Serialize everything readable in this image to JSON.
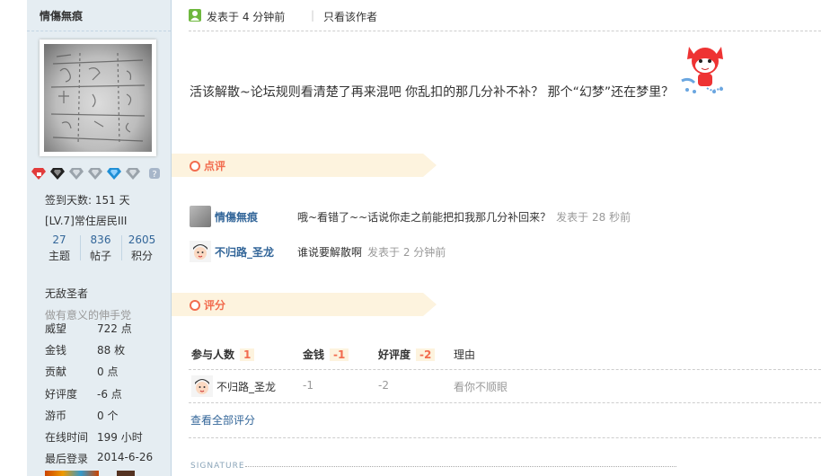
{
  "author": {
    "username": "情傷無痕",
    "sign_days": "签到天数: 151 天",
    "level": "[LV.7]常住居民III",
    "stats": [
      {
        "value": "27",
        "label": "主题"
      },
      {
        "value": "836",
        "label": "帖子"
      },
      {
        "value": "2605",
        "label": "积分"
      }
    ],
    "group": "无敌圣者",
    "group_sub": "做有意义的伸手党",
    "profile": [
      {
        "key": "威望",
        "value": "722 点"
      },
      {
        "key": "金钱",
        "value": "88 枚"
      },
      {
        "key": "贡献",
        "value": "0 点"
      },
      {
        "key": "好评度",
        "value": "-6 点"
      },
      {
        "key": "游币",
        "value": "0 个"
      },
      {
        "key": "在线时间",
        "value": "199 小时"
      },
      {
        "key": "最后登录",
        "value": "2014-6-26"
      }
    ],
    "medal_icons": [
      "red-gem-icon",
      "black-gem-icon",
      "diamond-icon",
      "diamond-icon",
      "blue-diamond-icon",
      "diamond-icon",
      "help-icon"
    ]
  },
  "post": {
    "posted": "发表于 4 分钟前",
    "separator": "|",
    "only_author": "只看该作者",
    "content": "活该解散~论坛规则看清楚了再来混吧    你乱扣的那几分补不补？ 那个“幻梦”还在梦里？",
    "emote_icon": "red-fox-cartoon-icon"
  },
  "comments": {
    "section_title": "点评",
    "items": [
      {
        "user": "情傷無痕",
        "text": "哦~看错了~~话说你走之前能把扣我那几分补回来？",
        "time": "发表于 28 秒前"
      },
      {
        "user": "不归路_圣龙",
        "text": "谁说要解散啊",
        "time": "发表于 2 分钟前"
      }
    ]
  },
  "rating": {
    "section_title": "评分",
    "headers": [
      {
        "label": "参与人数",
        "badge": "1"
      },
      {
        "label": "金钱",
        "badge": "-1"
      },
      {
        "label": "好评度",
        "badge": "-2"
      },
      {
        "label": "理由",
        "badge": ""
      }
    ],
    "rows": [
      {
        "user": "不归路_圣龙",
        "money": "-1",
        "reputation": "-2",
        "reason": "看你不顺眼"
      }
    ],
    "see_all": "查看全部评分"
  },
  "signature_label": "SIGNATURE",
  "colors": {
    "accent": "#f26c4f",
    "link": "#336699",
    "sidebar_bg": "#e5edf2",
    "band_bg": "#fdf3de"
  }
}
